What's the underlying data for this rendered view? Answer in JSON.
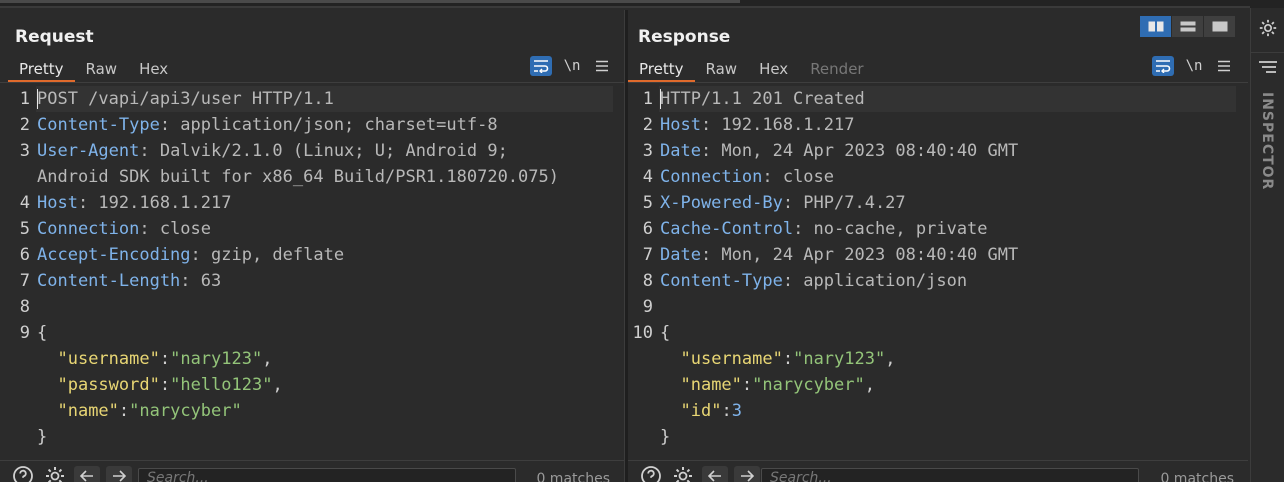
{
  "request": {
    "title": "Request",
    "tabs": [
      {
        "label": "Pretty",
        "active": true
      },
      {
        "label": "Raw"
      },
      {
        "label": "Hex"
      }
    ],
    "newline_toggle": "\\n",
    "lines": [
      {
        "num": "1",
        "parts": [
          {
            "t": "POST /vapi/api3/user HTTP/1.1",
            "c": "v"
          }
        ]
      },
      {
        "num": "2",
        "parts": [
          {
            "t": "Content-Type",
            "c": "k"
          },
          {
            "t": ": application/json; charset=utf-8",
            "c": "v"
          }
        ]
      },
      {
        "num": "3",
        "parts": [
          {
            "t": "User-Agent",
            "c": "k"
          },
          {
            "t": ": Dalvik/2.1.0 (Linux; U; Android 9;",
            "c": "v"
          }
        ]
      },
      {
        "num": "",
        "parts": [
          {
            "t": "Android SDK built for x86_64 Build/PSR1.180720.075)",
            "c": "v"
          }
        ]
      },
      {
        "num": "4",
        "parts": [
          {
            "t": "Host",
            "c": "k"
          },
          {
            "t": ": 192.168.1.217",
            "c": "v"
          }
        ]
      },
      {
        "num": "5",
        "parts": [
          {
            "t": "Connection",
            "c": "k"
          },
          {
            "t": ": close",
            "c": "v"
          }
        ]
      },
      {
        "num": "6",
        "parts": [
          {
            "t": "Accept-Encoding",
            "c": "k"
          },
          {
            "t": ": gzip, deflate",
            "c": "v"
          }
        ]
      },
      {
        "num": "7",
        "parts": [
          {
            "t": "Content-Length",
            "c": "k"
          },
          {
            "t": ": 63",
            "c": "v"
          }
        ]
      },
      {
        "num": "8",
        "parts": []
      },
      {
        "num": "9",
        "parts": [
          {
            "t": "{",
            "c": "p"
          }
        ]
      },
      {
        "num": "",
        "parts": [
          {
            "t": "  ",
            "c": "p"
          },
          {
            "t": "\"username\"",
            "c": "jk"
          },
          {
            "t": ":",
            "c": "p"
          },
          {
            "t": "\"nary123\"",
            "c": "js"
          },
          {
            "t": ",",
            "c": "p"
          }
        ]
      },
      {
        "num": "",
        "parts": [
          {
            "t": "  ",
            "c": "p"
          },
          {
            "t": "\"password\"",
            "c": "jk"
          },
          {
            "t": ":",
            "c": "p"
          },
          {
            "t": "\"hello123\"",
            "c": "js"
          },
          {
            "t": ",",
            "c": "p"
          }
        ]
      },
      {
        "num": "",
        "parts": [
          {
            "t": "  ",
            "c": "p"
          },
          {
            "t": "\"name\"",
            "c": "jk"
          },
          {
            "t": ":",
            "c": "p"
          },
          {
            "t": "\"narycyber\"",
            "c": "js"
          }
        ]
      },
      {
        "num": "",
        "parts": [
          {
            "t": "}",
            "c": "p"
          }
        ]
      }
    ],
    "search": {
      "placeholder": "Search...",
      "matches": "0 matches"
    }
  },
  "response": {
    "title": "Response",
    "tabs": [
      {
        "label": "Pretty",
        "active": true
      },
      {
        "label": "Raw"
      },
      {
        "label": "Hex"
      },
      {
        "label": "Render",
        "disabled": true
      }
    ],
    "newline_toggle": "\\n",
    "lines": [
      {
        "num": "1",
        "parts": [
          {
            "t": "HTTP/1.1 201 Created",
            "c": "v"
          }
        ]
      },
      {
        "num": "2",
        "parts": [
          {
            "t": "Host",
            "c": "k"
          },
          {
            "t": ": 192.168.1.217",
            "c": "v"
          }
        ]
      },
      {
        "num": "3",
        "parts": [
          {
            "t": "Date",
            "c": "k"
          },
          {
            "t": ": Mon, 24 Apr 2023 08:40:40 GMT",
            "c": "v"
          }
        ]
      },
      {
        "num": "4",
        "parts": [
          {
            "t": "Connection",
            "c": "k"
          },
          {
            "t": ": close",
            "c": "v"
          }
        ]
      },
      {
        "num": "5",
        "parts": [
          {
            "t": "X-Powered-By",
            "c": "k"
          },
          {
            "t": ": PHP/7.4.27",
            "c": "v"
          }
        ]
      },
      {
        "num": "6",
        "parts": [
          {
            "t": "Cache-Control",
            "c": "k"
          },
          {
            "t": ": no-cache, private",
            "c": "v"
          }
        ]
      },
      {
        "num": "7",
        "parts": [
          {
            "t": "Date",
            "c": "k"
          },
          {
            "t": ": Mon, 24 Apr 2023 08:40:40 GMT",
            "c": "v"
          }
        ]
      },
      {
        "num": "8",
        "parts": [
          {
            "t": "Content-Type",
            "c": "k"
          },
          {
            "t": ": application/json",
            "c": "v"
          }
        ]
      },
      {
        "num": "9",
        "parts": []
      },
      {
        "num": "10",
        "parts": [
          {
            "t": "{",
            "c": "p"
          }
        ]
      },
      {
        "num": "",
        "parts": [
          {
            "t": "  ",
            "c": "p"
          },
          {
            "t": "\"username\"",
            "c": "jk"
          },
          {
            "t": ":",
            "c": "p"
          },
          {
            "t": "\"nary123\"",
            "c": "js"
          },
          {
            "t": ",",
            "c": "p"
          }
        ]
      },
      {
        "num": "",
        "parts": [
          {
            "t": "  ",
            "c": "p"
          },
          {
            "t": "\"name\"",
            "c": "jk"
          },
          {
            "t": ":",
            "c": "p"
          },
          {
            "t": "\"narycyber\"",
            "c": "js"
          },
          {
            "t": ",",
            "c": "p"
          }
        ]
      },
      {
        "num": "",
        "parts": [
          {
            "t": "  ",
            "c": "p"
          },
          {
            "t": "\"id\"",
            "c": "jk"
          },
          {
            "t": ":",
            "c": "p"
          },
          {
            "t": "3",
            "c": "jn"
          }
        ]
      },
      {
        "num": "",
        "parts": [
          {
            "t": "}",
            "c": "p"
          }
        ]
      }
    ],
    "search": {
      "placeholder": "Search...",
      "matches": "0 matches"
    }
  },
  "inspector": {
    "label": "INSPECTOR"
  },
  "colors": {
    "accent": "#e06a2c",
    "active_button": "#2f6db3",
    "header_key": "#7fb3ea",
    "json_key": "#e8d674",
    "json_string": "#93c479"
  },
  "icons": [
    "wrap-lines-icon",
    "menu-icon",
    "help-icon",
    "gear-icon",
    "arrow-left-icon",
    "arrow-right-icon",
    "layout-side-by-side-icon",
    "layout-stacked-icon",
    "layout-tabbed-icon",
    "filter-icon"
  ]
}
